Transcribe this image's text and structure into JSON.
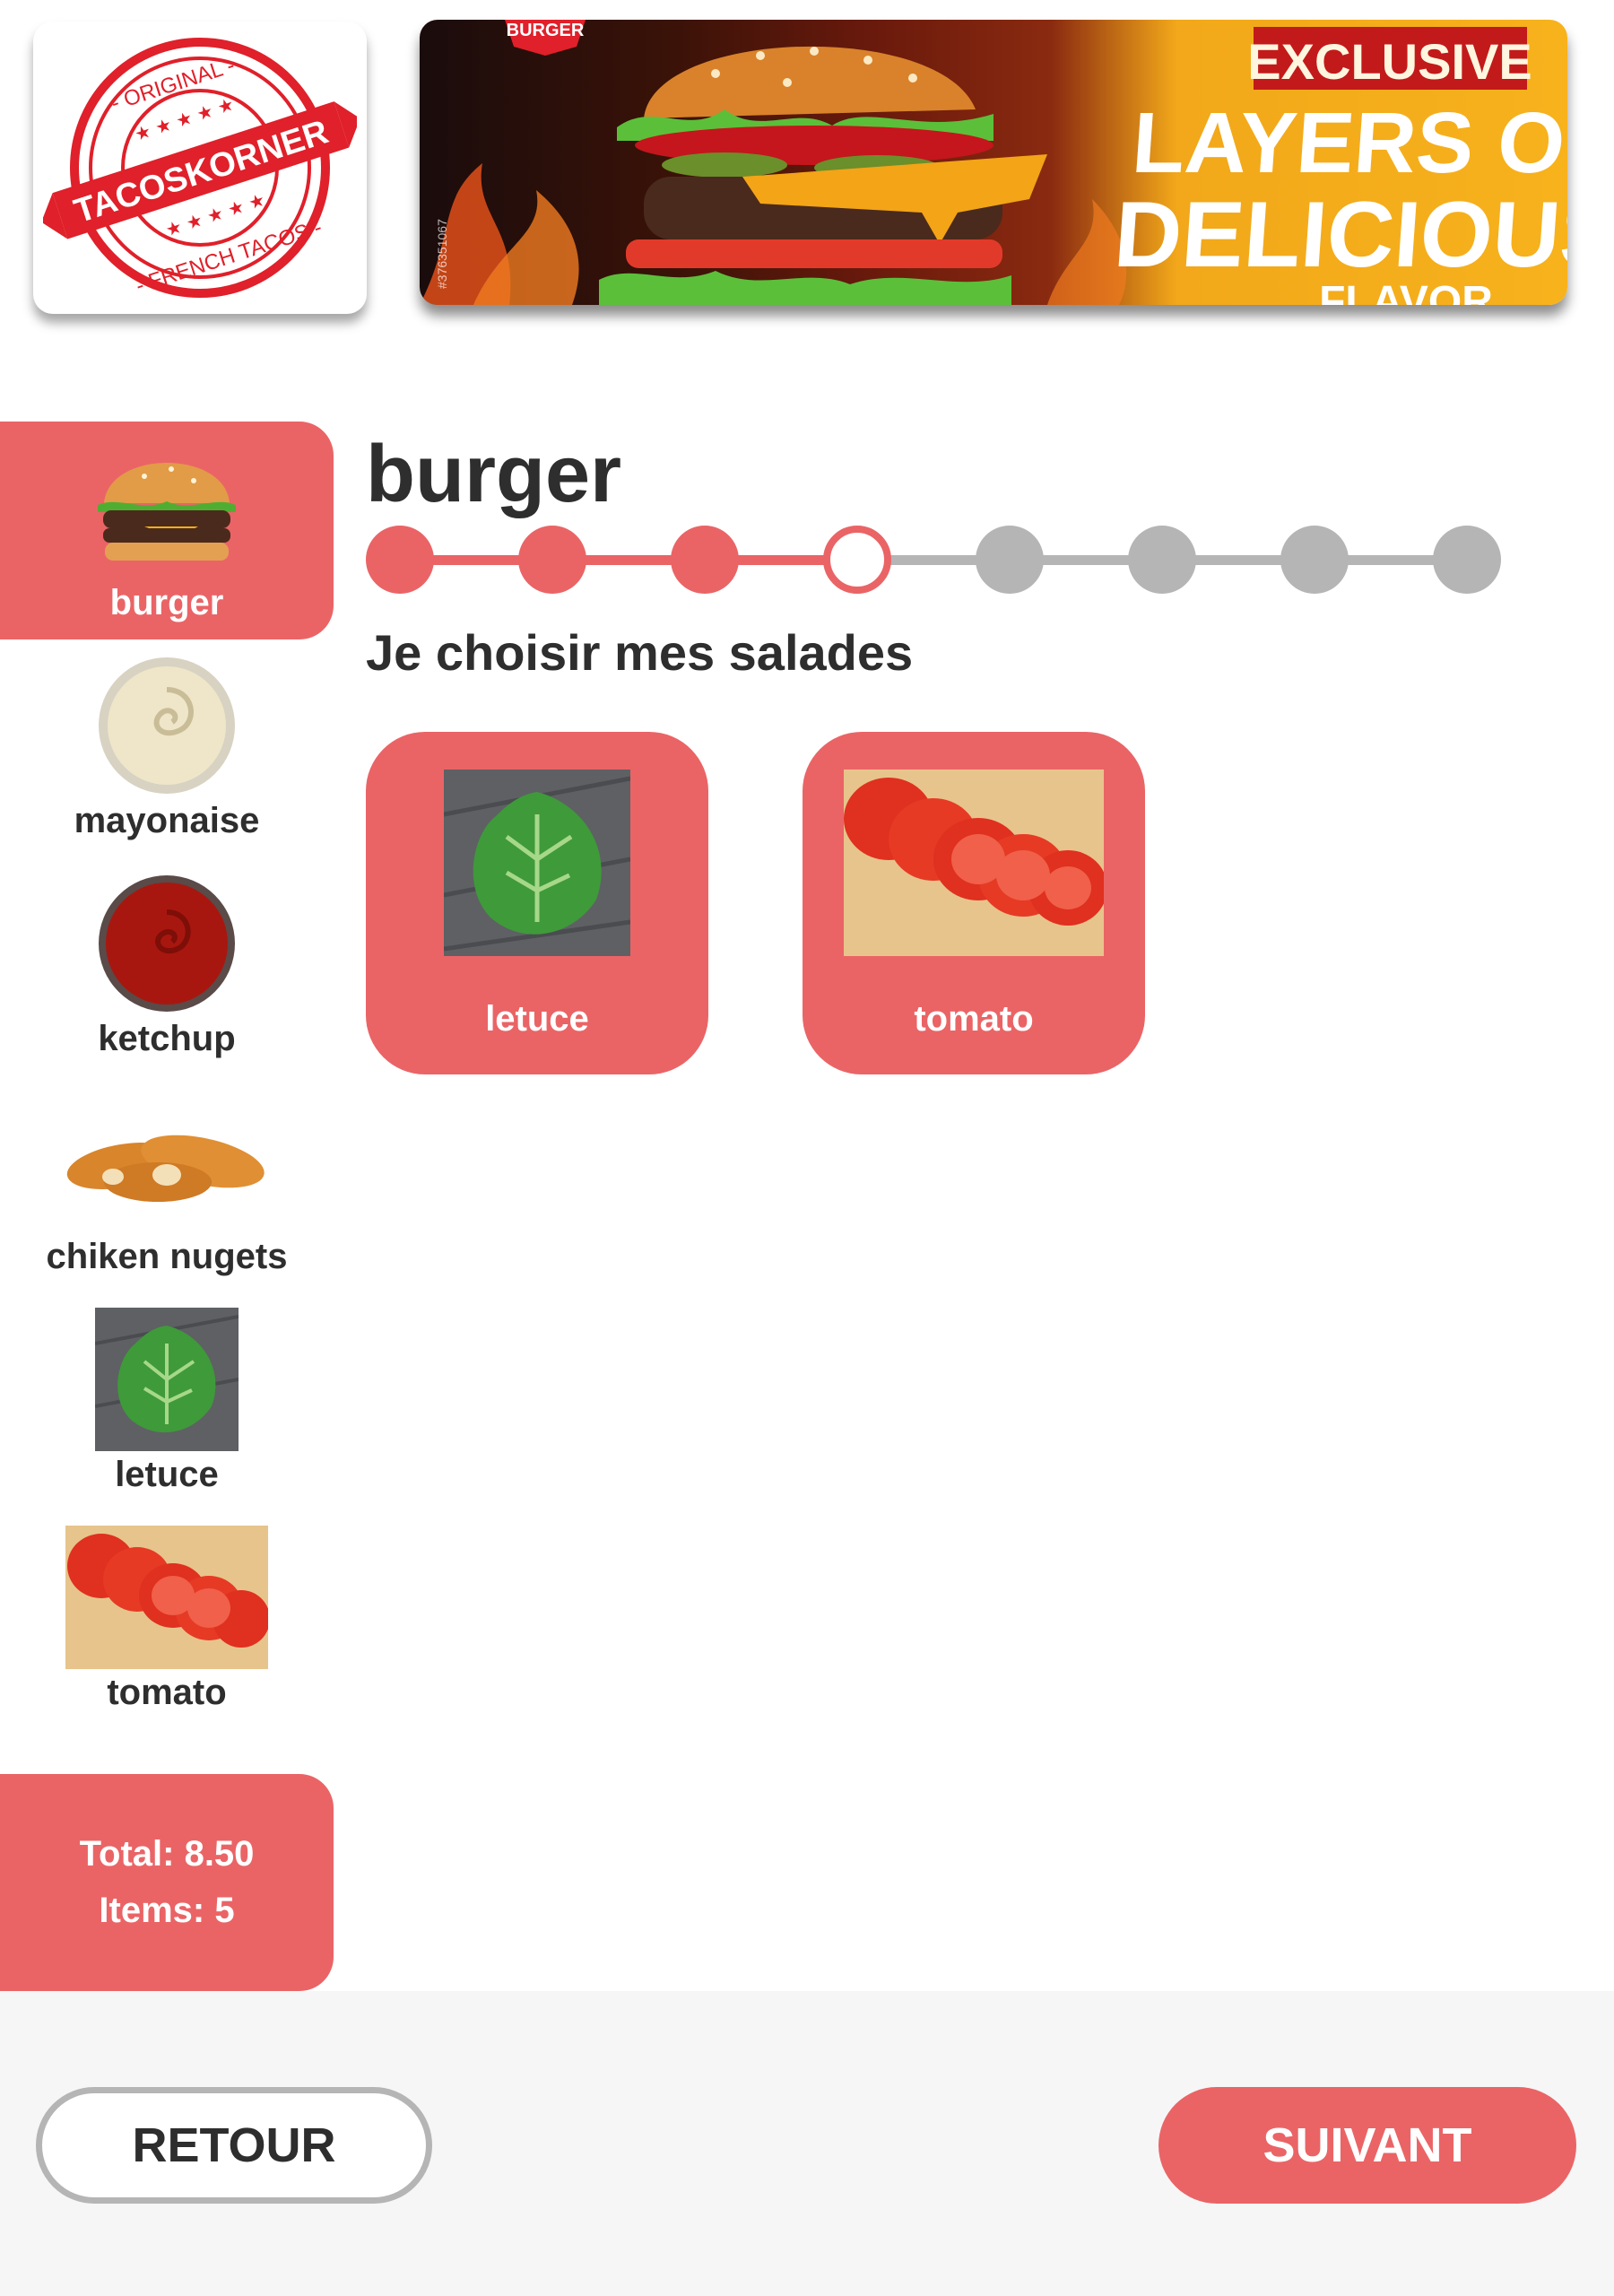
{
  "header": {
    "logo": {
      "brand": "TACOSKORNER",
      "top_text": "ORIGINAL",
      "bottom_text": "FRENCH TACOS"
    },
    "banner": {
      "tag": "BURGER",
      "headline_1": "EXCLUSIVE",
      "headline_2": "LAYERS OF",
      "headline_3": "DELICIOUS",
      "cut_text": "FLAVOR",
      "stock_id": "#376351067"
    }
  },
  "sidebar": {
    "items": [
      {
        "label": "burger",
        "icon": "burger-icon",
        "active": true
      },
      {
        "label": "mayonaise",
        "icon": "mayonnaise-bowl-icon",
        "active": false
      },
      {
        "label": "ketchup",
        "icon": "ketchup-bowl-icon",
        "active": false
      },
      {
        "label": "chiken nugets",
        "icon": "chicken-nuggets-icon",
        "active": false
      },
      {
        "label": "letuce",
        "icon": "lettuce-photo",
        "active": false
      },
      {
        "label": "tomato",
        "icon": "tomato-photo",
        "active": false
      }
    ],
    "summary": {
      "total": "Total: 8.50",
      "items": "Items: 5"
    }
  },
  "main": {
    "title": "burger",
    "stepper": {
      "total_steps": 8,
      "current_step": 4
    },
    "subtitle": "Je choisir mes salades",
    "choices": [
      {
        "label": "letuce",
        "image": "lettuce-photo"
      },
      {
        "label": "tomato",
        "image": "tomato-photo"
      }
    ]
  },
  "footer": {
    "back_label": "RETOUR",
    "next_label": "SUIVANT"
  },
  "colors": {
    "accent": "#ea6466",
    "inactive": "#b5b5b5",
    "text": "#2e2e2e",
    "footer_bg": "#f6f6f6"
  }
}
